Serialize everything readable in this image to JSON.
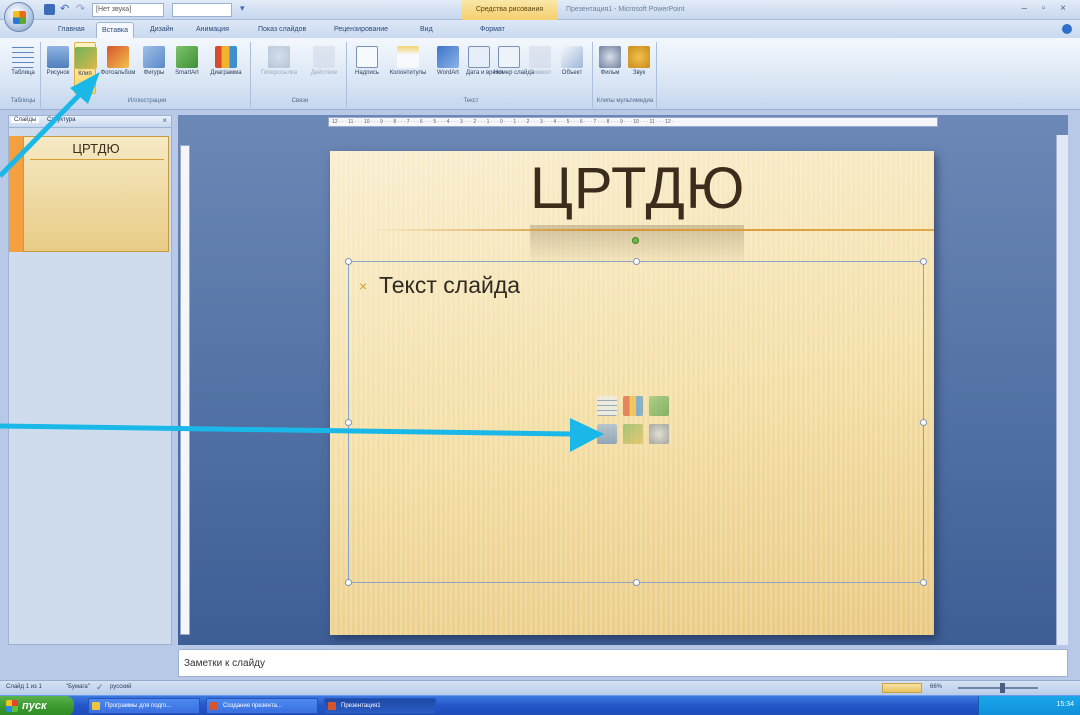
{
  "titlebar": {
    "sound_combo": "[Нет звука]",
    "context_tab": "Средства рисования",
    "window_title": "Презентация1 - Microsoft PowerPoint",
    "controls": "– ▫ ×"
  },
  "ribbon_tabs": [
    "Главная",
    "Вставка",
    "Дизайн",
    "Анимация",
    "Показ слайдов",
    "Рецензирование",
    "Вид",
    "Формат"
  ],
  "ribbon": {
    "buttons": {
      "table": "Таблица",
      "picture": "Рисунок",
      "clip": "Клип",
      "photoalbum": "Фотоальбом",
      "shapes": "Фигуры",
      "smartart": "SmartArt",
      "chart": "Диаграмма",
      "hyperlink": "Гиперссылка",
      "action": "Действие",
      "textbox": "Надпись",
      "header_footer": "Колонтитулы",
      "wordart": "WordArt",
      "datetime": "Дата и время",
      "slide_number": "Номер слайда",
      "symbol": "Символ",
      "object": "Объект",
      "movie": "Фильм",
      "sound": "Звук"
    },
    "groups": {
      "tables": "Таблицы",
      "illustrations": "Иллюстрации",
      "links": "Связи",
      "text": "Текст",
      "media": "Клипы мультимедиа"
    }
  },
  "panel": {
    "tab_slides": "Слайды",
    "tab_structure": "Структура",
    "close": "×",
    "thumb_title": "ЦРТДЮ"
  },
  "slide": {
    "title": "ЦРТДЮ",
    "bullet": "×",
    "body_text": "Текст слайда"
  },
  "notes": {
    "placeholder": "Заметки к слайду"
  },
  "status": {
    "slide_info": "Слайд 1 из 1",
    "theme": "\"Бумага\"",
    "language": "русский",
    "zoom": "66%"
  },
  "taskbar": {
    "start": "пуск",
    "tasks": [
      "Программы для подго...",
      "Создание презента...",
      "Презентация1"
    ],
    "time": "15:34"
  },
  "colors": {
    "arrow": "#19b8e8",
    "desktop_blue": "#0b0fa8",
    "slide_title": "#3b2c1c"
  }
}
